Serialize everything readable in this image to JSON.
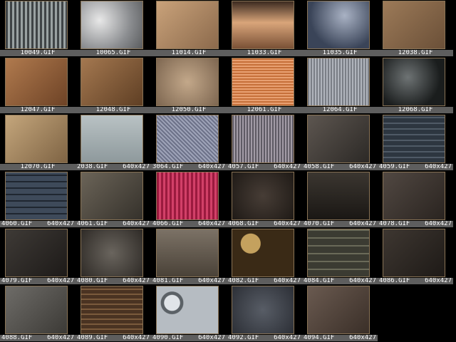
{
  "thumbnails": [
    {
      "file": "10049.GIF",
      "dims": "",
      "bg": "repeating-linear-gradient(90deg,#3f4446 0 3px,#9aa2a2 3px 6px)"
    },
    {
      "file": "10065.GIF",
      "dims": "",
      "bg": "radial-gradient(circle at 30% 40%,#e8e8e8,#8b8d90 60%,#5a5c5e)"
    },
    {
      "file": "11014.GIF",
      "dims": "",
      "bg": "linear-gradient(135deg,#c9a27a,#8c6a4c)"
    },
    {
      "file": "11033.GIF",
      "dims": "",
      "bg": "linear-gradient(180deg,#3b2a20,#d9a57a 45%,#7a5136)"
    },
    {
      "file": "11035.GIF",
      "dims": "",
      "bg": "radial-gradient(circle at 60% 30%,#a9b2c4,#3a4458 70%)"
    },
    {
      "file": "12038.GIF",
      "dims": "",
      "bg": "linear-gradient(135deg,#9c7a58,#6b5038)"
    },
    {
      "file": "12047.GIF",
      "dims": "",
      "bg": "linear-gradient(135deg,#b07a4e,#6e4326)"
    },
    {
      "file": "12048.GIF",
      "dims": "",
      "bg": "linear-gradient(135deg,#a47850,#5f3f24)"
    },
    {
      "file": "12050.GIF",
      "dims": "",
      "bg": "radial-gradient(circle,#c3a88a,#7d6650)"
    },
    {
      "file": "12061.GIF",
      "dims": "",
      "bg": "repeating-linear-gradient(0deg,#c6703a 0 2px,#e8a071 2px 4px)"
    },
    {
      "file": "12064.GIF",
      "dims": "",
      "bg": "repeating-linear-gradient(90deg,#7a7e86 0 2px,#b0b4bc 2px 4px)"
    },
    {
      "file": "12068.GIF",
      "dims": "",
      "bg": "radial-gradient(circle at 40% 40%,#6e7374,#1a1d1d 70%)"
    },
    {
      "file": "12070.GIF",
      "dims": "",
      "bg": "linear-gradient(135deg,#c4a67c,#7f6444)"
    },
    {
      "file": "2038.GIF",
      "dims": "640x427",
      "bg": "linear-gradient(180deg,#b9c2c4,#8e999c)"
    },
    {
      "file": "3064.GIF",
      "dims": "640x427",
      "bg": "repeating-linear-gradient(45deg,#6d7289 0 2px,#9ea3b8 2px 4px)"
    },
    {
      "file": "4057.GIF",
      "dims": "640x427",
      "bg": "repeating-linear-gradient(90deg,#5e5a64 0 2px,#a29ba6 2px 4px)"
    },
    {
      "file": "4058.GIF",
      "dims": "640x427",
      "bg": "linear-gradient(135deg,#5d5650,#2c2926)"
    },
    {
      "file": "4059.GIF",
      "dims": "640x427",
      "bg": "repeating-linear-gradient(0deg,#2d3640 0 6px,#4f5a66 6px 8px)"
    },
    {
      "file": "4060.GIF",
      "dims": "640x427",
      "bg": "repeating-linear-gradient(0deg,#3e4a5a 0 7px,#1f2630 7px 9px)"
    },
    {
      "file": "4061.GIF",
      "dims": "640x427",
      "bg": "linear-gradient(135deg,#6b6458,#35312b)"
    },
    {
      "file": "4066.GIF",
      "dims": "640x427",
      "bg": "repeating-linear-gradient(90deg,#9a1a3e 0 3px,#d24068 3px 6px)"
    },
    {
      "file": "4068.GIF",
      "dims": "640x427",
      "bg": "radial-gradient(circle,#473d36,#1f1a16)"
    },
    {
      "file": "4070.GIF",
      "dims": "640x427",
      "bg": "linear-gradient(180deg,#3b3630,#1a1714)"
    },
    {
      "file": "4078.GIF",
      "dims": "640x427",
      "bg": "linear-gradient(135deg,#514842,#2a2420)"
    },
    {
      "file": "4079.GIF",
      "dims": "640x427",
      "bg": "linear-gradient(135deg,#3e3a36,#1d1a18)"
    },
    {
      "file": "4080.GIF",
      "dims": "640x427",
      "bg": "radial-gradient(circle at 50% 50%,#6a655e,#2e2a26)"
    },
    {
      "file": "4081.GIF",
      "dims": "640x427",
      "bg": "linear-gradient(180deg,#7c7266,#4a4238)"
    },
    {
      "file": "4082.GIF",
      "dims": "640x427",
      "bg": "radial-gradient(circle at 30% 30%,#c4a15e 0 18%,#3a2a16 19%)"
    },
    {
      "file": "4084.GIF",
      "dims": "640x427",
      "bg": "repeating-linear-gradient(0deg,#3b3b32 0 9px,#6a6a58 9px 11px)"
    },
    {
      "file": "4086.GIF",
      "dims": "640x427",
      "bg": "linear-gradient(135deg,#3e3731,#1e1a17)"
    },
    {
      "file": "4088.GIF",
      "dims": "640x427",
      "bg": "linear-gradient(135deg,#6e6c68,#3c3a36)"
    },
    {
      "file": "4089.GIF",
      "dims": "640x427",
      "bg": "repeating-linear-gradient(0deg,#4a3322 0 5px,#7a5a3c 5px 7px)"
    },
    {
      "file": "4090.GIF",
      "dims": "640x427",
      "bg": "radial-gradient(circle at 25% 35%,#e0e4e8 0 14%,#5b6166 15% 20%,#b6bcc2 21%)"
    },
    {
      "file": "4092.GIF",
      "dims": "640x427",
      "bg": "radial-gradient(circle,#585d66,#2c2f36)"
    },
    {
      "file": "4094.GIF",
      "dims": "640x427",
      "bg": "linear-gradient(135deg,#6a5a50,#3a2f28)"
    }
  ]
}
